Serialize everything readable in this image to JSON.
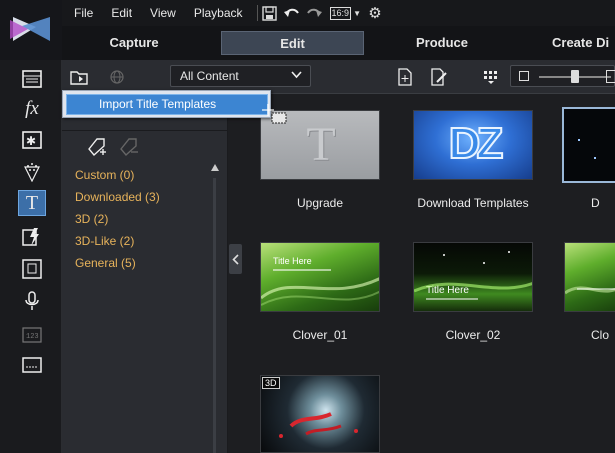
{
  "menu": {
    "file": "File",
    "edit": "Edit",
    "view": "View",
    "playback": "Playback",
    "aspect_ratio": "16:9"
  },
  "modes": {
    "capture": "Capture",
    "edit": "Edit",
    "produce": "Produce",
    "create_disc": "Create Di"
  },
  "toolbar": {
    "content_filter": "All Content"
  },
  "popup": {
    "import_templates": "Import Title Templates"
  },
  "categories": [
    {
      "label": "Custom  (0)"
    },
    {
      "label": "Downloaded  (3)"
    },
    {
      "label": "3D  (2)"
    },
    {
      "label": "3D-Like  (2)"
    },
    {
      "label": "General  (5)"
    }
  ],
  "tiles": [
    {
      "label": "Upgrade",
      "glyph": "T"
    },
    {
      "label": "Download Templates",
      "glyph": "DZ"
    },
    {
      "label": "D"
    },
    {
      "label": "Clover_01",
      "overlay": "Title Here"
    },
    {
      "label": "Clover_02",
      "overlay": "Title Here"
    },
    {
      "label": "Clo"
    },
    {
      "badge": "3D"
    }
  ],
  "colors": {
    "accent": "#3c85d2",
    "category_text": "#e7b35b",
    "active_tab": "#3d4654"
  }
}
